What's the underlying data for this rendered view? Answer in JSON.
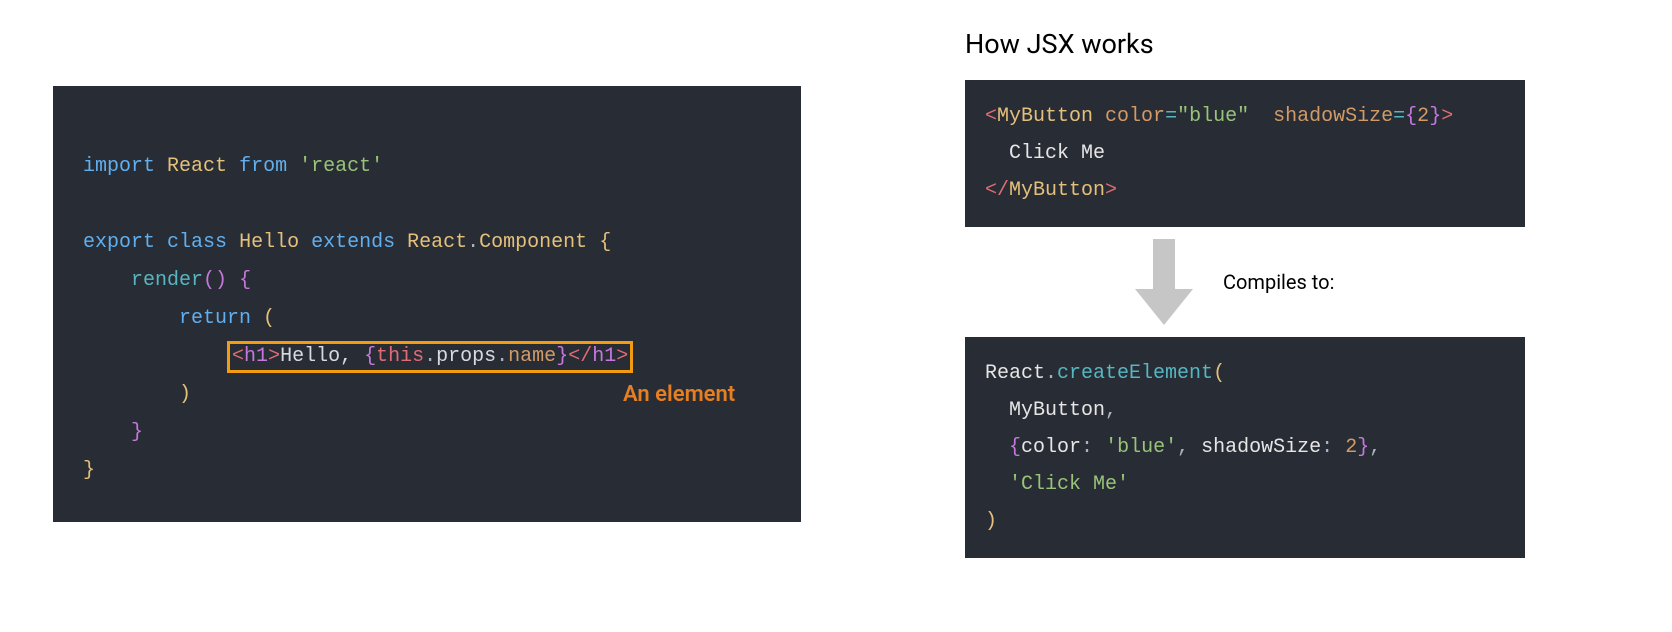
{
  "left": {
    "code": {
      "import_kw": "import",
      "react1": "React",
      "from_kw": "from",
      "react_str": "'react'",
      "export_kw": "export",
      "class_kw": "class",
      "hello": "Hello",
      "extends_kw": "extends",
      "react2": "React",
      "dot1": ".",
      "component": "Component",
      "lbrace": "{",
      "render": "render",
      "parens": "()",
      "lbrace2": "{",
      "return_kw": "return",
      "lparen": "(",
      "tag_open_lt": "<",
      "tag_open_name": "h1",
      "tag_open_gt": ">",
      "hello_text": "Hello, ",
      "expr_open": "{",
      "this_kw": "this",
      "dot2": ".",
      "props": "props",
      "dot3": ".",
      "name": "name",
      "expr_close": "}",
      "tag_close_lt": "</",
      "tag_close_name": "h1",
      "tag_close_gt": ">",
      "rparen": ")",
      "rbrace2": "}",
      "rbrace": "}"
    },
    "annotation": "An element"
  },
  "right": {
    "heading": "How JSX works",
    "jsx": {
      "open_lt": "<",
      "mybutton": "MyButton",
      "attr_color": "color",
      "eq1": "=",
      "color_val": "\"blue\"",
      "attr_shadow": "shadowSize",
      "eq2": "=",
      "expr_open": "{",
      "num2": "2",
      "expr_close": "}",
      "open_gt": ">",
      "text": "Click Me",
      "close_lt": "</",
      "mybutton2": "MyButton",
      "close_gt": ">"
    },
    "compiles_label": "Compiles to:",
    "output": {
      "react": "React",
      "dot": ".",
      "createElement": "createElement",
      "lparen": "(",
      "mybutton": "MyButton",
      "comma1": ",",
      "obj_open": "{",
      "color_key": "color",
      "colon1": ":",
      "color_val": "'blue'",
      "comma2": ",",
      "shadow_key": "shadowSize",
      "colon2": ":",
      "shadow_val": "2",
      "obj_close": "}",
      "comma3": ",",
      "click_str": "'Click Me'",
      "rparen": ")"
    }
  }
}
